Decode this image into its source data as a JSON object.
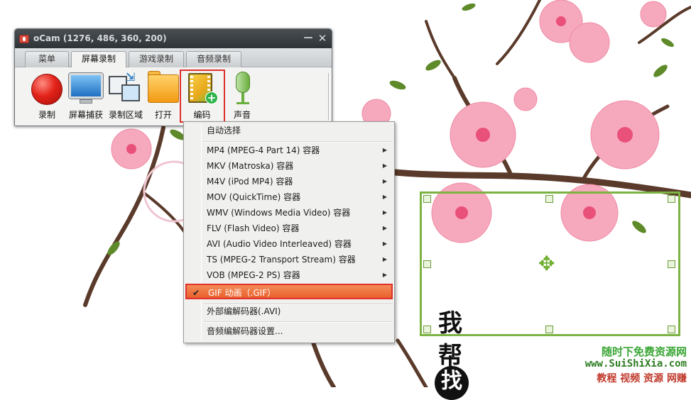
{
  "window": {
    "title": "oCam (1276, 486, 360, 200)",
    "minimize": "—",
    "close": "✕"
  },
  "tabs": [
    {
      "label": "菜单"
    },
    {
      "label": "屏幕录制",
      "active": true
    },
    {
      "label": "游戏录制"
    },
    {
      "label": "音频录制"
    }
  ],
  "toolbar": {
    "record": "录制",
    "capture": "屏幕捕获",
    "region": "录制区域",
    "open": "打开",
    "encode": "编码",
    "audio": "声音"
  },
  "menu": {
    "auto": "自动选择",
    "formats": [
      "MP4 (MPEG-4 Part 14) 容器",
      "MKV (Matroska) 容器",
      "M4V (iPod MP4) 容器",
      "MOV (QuickTime) 容器",
      "WMV (Windows Media Video) 容器",
      "FLV (Flash Video) 容器",
      "AVI (Audio Video Interleaved) 容器",
      "TS (MPEG-2 Transport Stream) 容器",
      "VOB (MPEG-2 PS) 容器"
    ],
    "gif": "GIF 动画（.GIF）",
    "external": "外部编解码器(.AVI)",
    "audio_settings": "音频编解码器设置...",
    "check": "✔",
    "submenu_arrow": "▶"
  },
  "canvas": {
    "calligraphy": [
      "我",
      "帮",
      "找"
    ],
    "move_icon": "✥"
  },
  "watermark": {
    "line1": "随时下免费资源网",
    "line2": "www.SuiShiXia.com",
    "line3": "教程 视频 资源 网赚"
  },
  "colors": {
    "accent_red": "#e0302d",
    "selection_green": "#7cb342",
    "menu_highlight": "#e9612d"
  }
}
